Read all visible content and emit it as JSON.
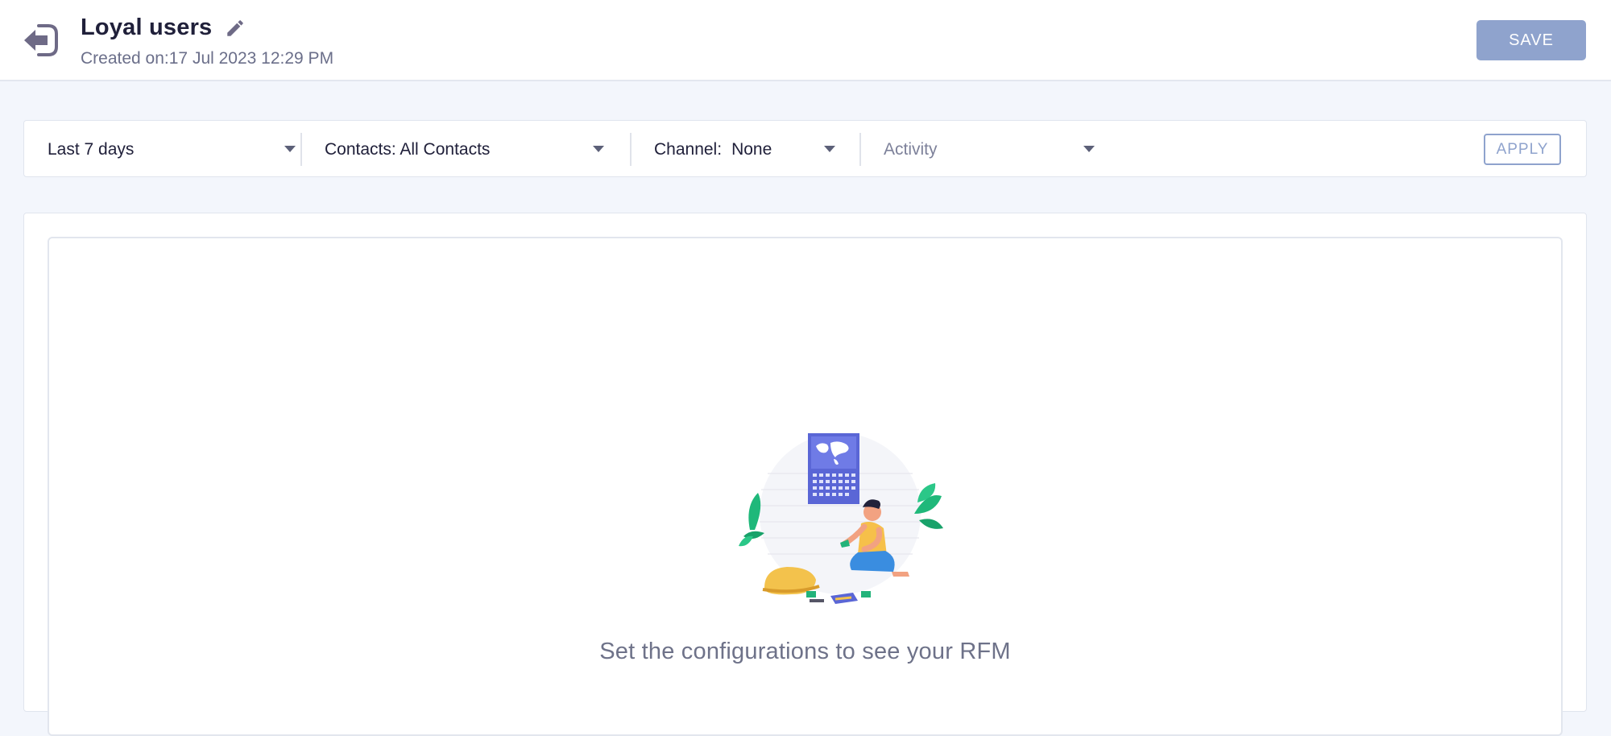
{
  "header": {
    "title": "Loyal users",
    "created_prefix": "Created on:",
    "created_date": "17 Jul 2023 12:29 PM",
    "save_label": "SAVE",
    "back_icon": "exit-arrow-icon",
    "edit_icon": "pencil-icon"
  },
  "filters": {
    "date_range": "Last 7 days",
    "contacts": "Contacts: All Contacts",
    "channel_label": "Channel:",
    "channel_value": "None",
    "activity_placeholder": "Activity",
    "apply_label": "APPLY"
  },
  "empty_state": {
    "message": "Set the configurations to see your RFM",
    "illustration": "person-sorting-cards-illustration"
  },
  "colors": {
    "primary_disabled": "#8fa3cd",
    "background": "#f3f6fc",
    "icon": "#6e6a86"
  }
}
